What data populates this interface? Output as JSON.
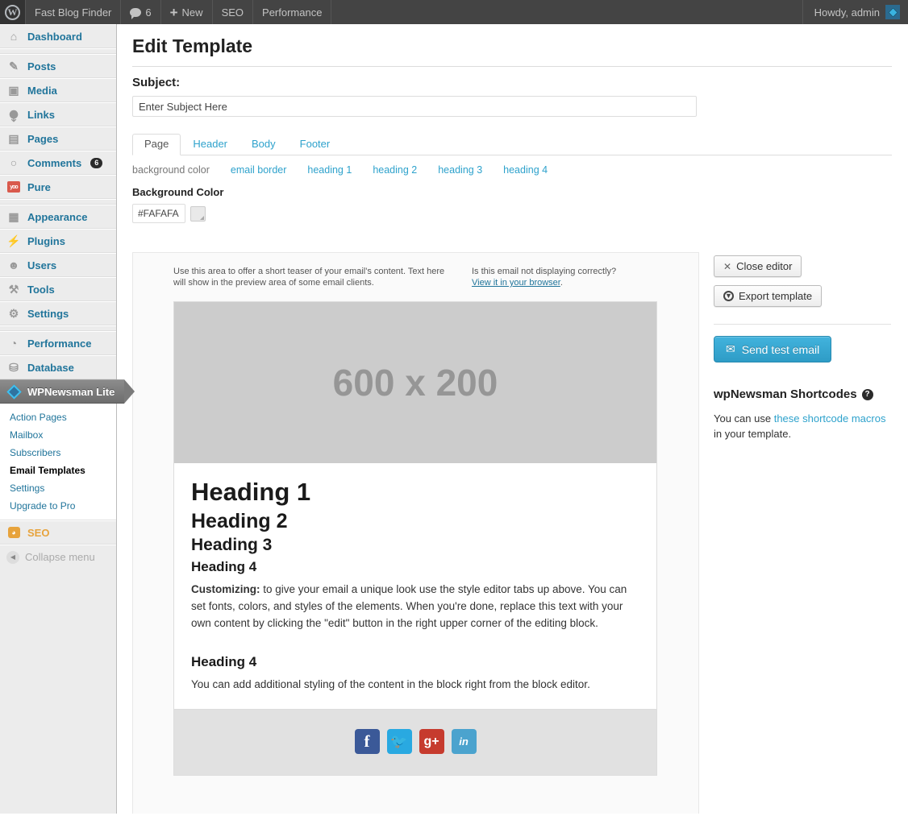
{
  "adminbar": {
    "logo_icon": "wordpress-logo-icon",
    "site_name": "Fast Blog Finder",
    "comments_icon": "comment-bubble-icon",
    "comments_count": "6",
    "new_icon": "plus-icon",
    "new_label": "New",
    "seo_label": "SEO",
    "performance_label": "Performance",
    "howdy": "Howdy, admin",
    "avatar_icon": "user-avatar-icon"
  },
  "sidebar": {
    "items": [
      {
        "label": "Dashboard",
        "icon": "dashboard-home-icon",
        "glyph": "⌂"
      },
      {
        "label": "Posts",
        "icon": "pin-icon",
        "glyph": "✎"
      },
      {
        "label": "Media",
        "icon": "media-camera-icon",
        "glyph": "▣"
      },
      {
        "label": "Links",
        "icon": "link-chain-icon",
        "glyph": "⚭"
      },
      {
        "label": "Pages",
        "icon": "pages-document-icon",
        "glyph": "▤"
      },
      {
        "label": "Comments",
        "icon": "comment-bubble-icon",
        "glyph": "○",
        "badge": "6"
      },
      {
        "label": "Pure",
        "icon": "pure-plugin-icon",
        "glyph": "yoo"
      }
    ],
    "items2": [
      {
        "label": "Appearance",
        "icon": "appearance-brush-icon",
        "glyph": "▦"
      },
      {
        "label": "Plugins",
        "icon": "plugin-plug-icon",
        "glyph": "⚡"
      },
      {
        "label": "Users",
        "icon": "users-icon",
        "glyph": "☻"
      },
      {
        "label": "Tools",
        "icon": "tools-icon",
        "glyph": "⚒"
      },
      {
        "label": "Settings",
        "icon": "settings-gear-icon",
        "glyph": "⚙"
      }
    ],
    "items3": [
      {
        "label": "Performance",
        "icon": "performance-icon",
        "glyph": "◔"
      },
      {
        "label": "Database",
        "icon": "database-icon",
        "glyph": "⛁"
      }
    ],
    "current": {
      "label": "WPNewsman Lite",
      "icon": "wpnewsman-diamond-icon"
    },
    "submenu": [
      {
        "label": "Action Pages",
        "current": false
      },
      {
        "label": "Mailbox",
        "current": false
      },
      {
        "label": "Subscribers",
        "current": false
      },
      {
        "label": "Email Templates",
        "current": true
      },
      {
        "label": "Settings",
        "current": false
      },
      {
        "label": "Upgrade to Pro",
        "current": false
      }
    ],
    "seo": {
      "label": "SEO",
      "icon": "seo-icon",
      "glyph": "◕"
    },
    "collapse": {
      "label": "Collapse menu",
      "icon": "collapse-arrow-icon",
      "glyph": "◀"
    }
  },
  "main": {
    "page_title": "Edit Template",
    "subject_label": "Subject:",
    "subject_value": "Enter Subject Here",
    "subject_placeholder": "Enter Subject Here",
    "tabs": [
      {
        "label": "Page",
        "active": true
      },
      {
        "label": "Header",
        "active": false
      },
      {
        "label": "Body",
        "active": false
      },
      {
        "label": "Footer",
        "active": false
      }
    ],
    "subnav": [
      {
        "label": "background color",
        "active": true
      },
      {
        "label": "email border",
        "active": false
      },
      {
        "label": "heading 1",
        "active": false
      },
      {
        "label": "heading 2",
        "active": false
      },
      {
        "label": "heading 3",
        "active": false
      },
      {
        "label": "heading 4",
        "active": false
      }
    ],
    "property_label": "Background Color",
    "color_value": "#FAFAFA",
    "color_swatch_name": "color-picker-swatch"
  },
  "preview": {
    "preheader_left": "Use this area to offer a short teaser of your email's content. Text here will show in the preview area of some email clients.",
    "preheader_right_text": "Is this email not displaying correctly?",
    "preheader_right_link": "View it in your browser",
    "preheader_right_suffix": ".",
    "hero_placeholder": "600 x 200",
    "heading1": "Heading 1",
    "heading2": "Heading 2",
    "heading3": "Heading 3",
    "heading4": "Heading 4",
    "paragraph_strong": "Customizing:",
    "paragraph_rest": " to give your email a unique look use the style editor tabs up above. You can set fonts, colors, and styles of the elements. When you're done, replace this text with your own content by clicking the \"edit\" button in the right upper corner of the editing block.",
    "heading4_second": "Heading 4",
    "paragraph_second": "You can add additional styling of the content in the block right from the block editor.",
    "social": [
      {
        "name": "facebook",
        "glyph": "f",
        "color": "#3b5998"
      },
      {
        "name": "twitter",
        "glyph": "ᵠ",
        "color": "#29a9e1"
      },
      {
        "name": "googleplus",
        "glyph": "g+",
        "color": "#c63b2e"
      },
      {
        "name": "linkedin",
        "glyph": "in",
        "color": "#4ba3ce"
      }
    ]
  },
  "panel": {
    "close_editor_icon": "close-x-icon",
    "close_editor_label": "Close editor",
    "export_icon": "download-circle-icon",
    "export_label": "Export template",
    "send_test_icon": "envelope-icon",
    "send_test_label": "Send test email",
    "shortcodes_title": "wpNewsman Shortcodes",
    "help_icon": "help-question-icon",
    "shortcodes_text_before": "You can use ",
    "shortcodes_link": "these shortcode macros",
    "shortcodes_text_after": " in your template."
  },
  "colors": {
    "accent_blue": "#2ea2cc",
    "link_blue": "#21759b",
    "admin_bar": "#444444",
    "sidebar_bg": "#ececec",
    "hero_bg": "#cccccc"
  }
}
